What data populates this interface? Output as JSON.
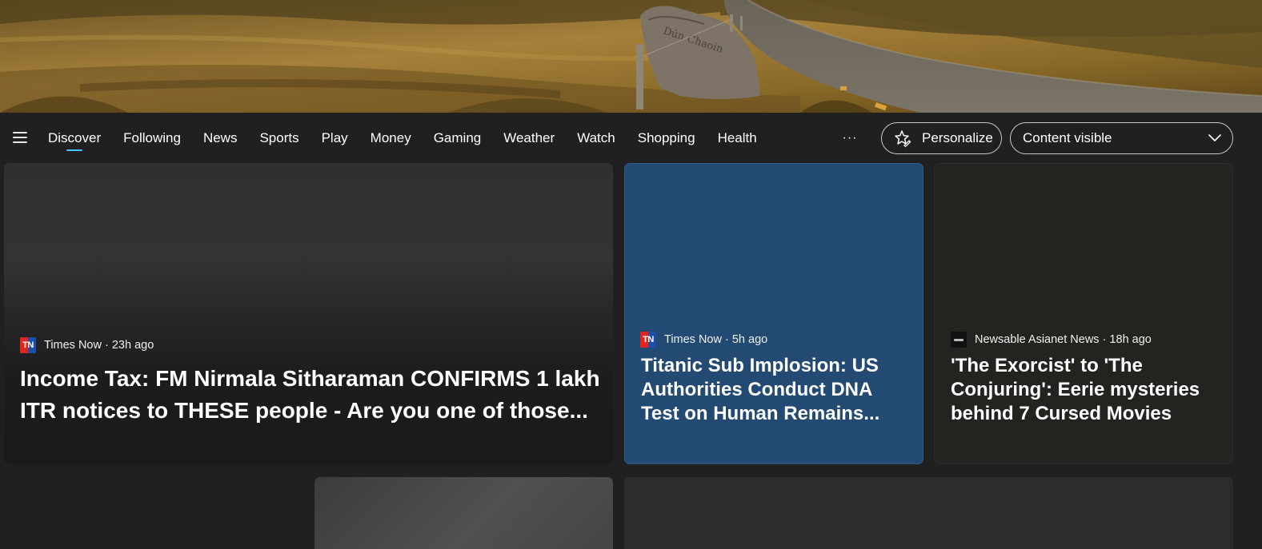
{
  "hero": {
    "sign_text": "Dún Chaoin"
  },
  "nav": {
    "menu_icon": "hamburger-menu-icon",
    "tabs": [
      {
        "label": "Discover",
        "active": true
      },
      {
        "label": "Following"
      },
      {
        "label": "News"
      },
      {
        "label": "Sports"
      },
      {
        "label": "Play"
      },
      {
        "label": "Money"
      },
      {
        "label": "Gaming"
      },
      {
        "label": "Weather"
      },
      {
        "label": "Watch"
      },
      {
        "label": "Shopping"
      },
      {
        "label": "Health"
      }
    ],
    "more_label": "···",
    "personalize_label": "Personalize",
    "personalize_icon": "sparkle-edit-icon",
    "content_select_value": "Content visible",
    "content_select_icon": "chevron-down-icon",
    "accent_color": "#4cc2ff"
  },
  "cards": [
    {
      "source": "Times Now",
      "time": "23h ago",
      "meta": "Times Now · 23h ago",
      "logo_text": "TN",
      "headline": "Income Tax: FM Nirmala Sitharaman CONFIRMS 1 lakh ITR notices to THESE people - Are you one of those..."
    },
    {
      "source": "Times Now",
      "time": "5h ago",
      "meta": "Times Now · 5h ago",
      "logo_text": "TN",
      "headline": "Titanic Sub Implosion: US Authorities Conduct DNA Test on Human Remains...",
      "background": "#224a72"
    },
    {
      "source": "Newsable Asianet News",
      "time": "18h ago",
      "meta": "Newsable Asianet News · 18h ago",
      "headline": "'The Exorcist' to 'The Conjuring': Eerie mysteries behind 7 Cursed Movies"
    }
  ]
}
